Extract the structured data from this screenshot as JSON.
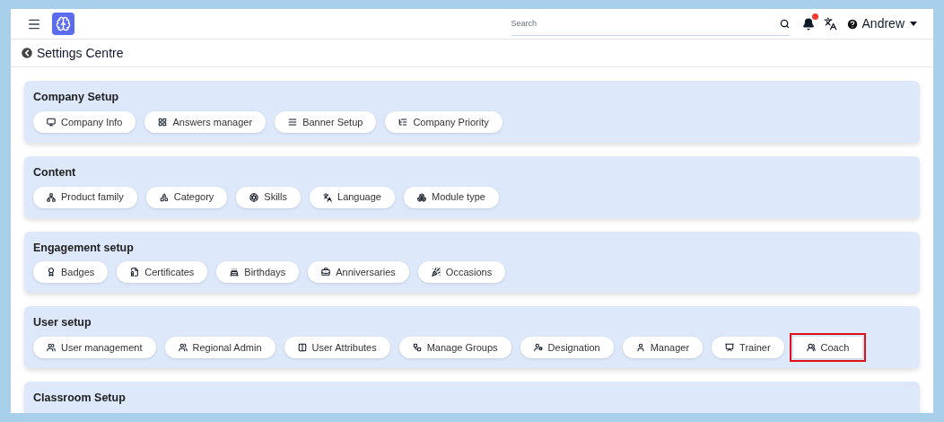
{
  "header": {
    "search": {
      "placeholder": "Search"
    },
    "notifications": {
      "unread": true
    },
    "user": {
      "name": "Andrew"
    }
  },
  "page": {
    "title": "Settings Centre"
  },
  "sections": [
    {
      "title": "Company Setup",
      "items": [
        {
          "label": "Company Info",
          "highlighted": false
        },
        {
          "label": "Answers manager",
          "highlighted": false
        },
        {
          "label": "Banner Setup",
          "highlighted": false
        },
        {
          "label": "Company Priority",
          "highlighted": false
        }
      ]
    },
    {
      "title": "Content",
      "items": [
        {
          "label": "Product family",
          "highlighted": false
        },
        {
          "label": "Category",
          "highlighted": false
        },
        {
          "label": "Skills",
          "highlighted": false
        },
        {
          "label": "Language",
          "highlighted": false
        },
        {
          "label": "Module type",
          "highlighted": false
        }
      ]
    },
    {
      "title": "Engagement setup",
      "items": [
        {
          "label": "Badges",
          "highlighted": false
        },
        {
          "label": "Certificates",
          "highlighted": false
        },
        {
          "label": "Birthdays",
          "highlighted": false
        },
        {
          "label": "Anniversaries",
          "highlighted": false
        },
        {
          "label": "Occasions",
          "highlighted": false
        }
      ]
    },
    {
      "title": "User setup",
      "items": [
        {
          "label": "User management",
          "highlighted": false
        },
        {
          "label": "Regional Admin",
          "highlighted": false
        },
        {
          "label": "User Attributes",
          "highlighted": false
        },
        {
          "label": "Manage Groups",
          "highlighted": false
        },
        {
          "label": "Designation",
          "highlighted": false
        },
        {
          "label": "Manager",
          "highlighted": false
        },
        {
          "label": "Trainer",
          "highlighted": false
        },
        {
          "label": "Coach",
          "highlighted": true
        }
      ]
    },
    {
      "title": "Classroom Setup"
    }
  ]
}
